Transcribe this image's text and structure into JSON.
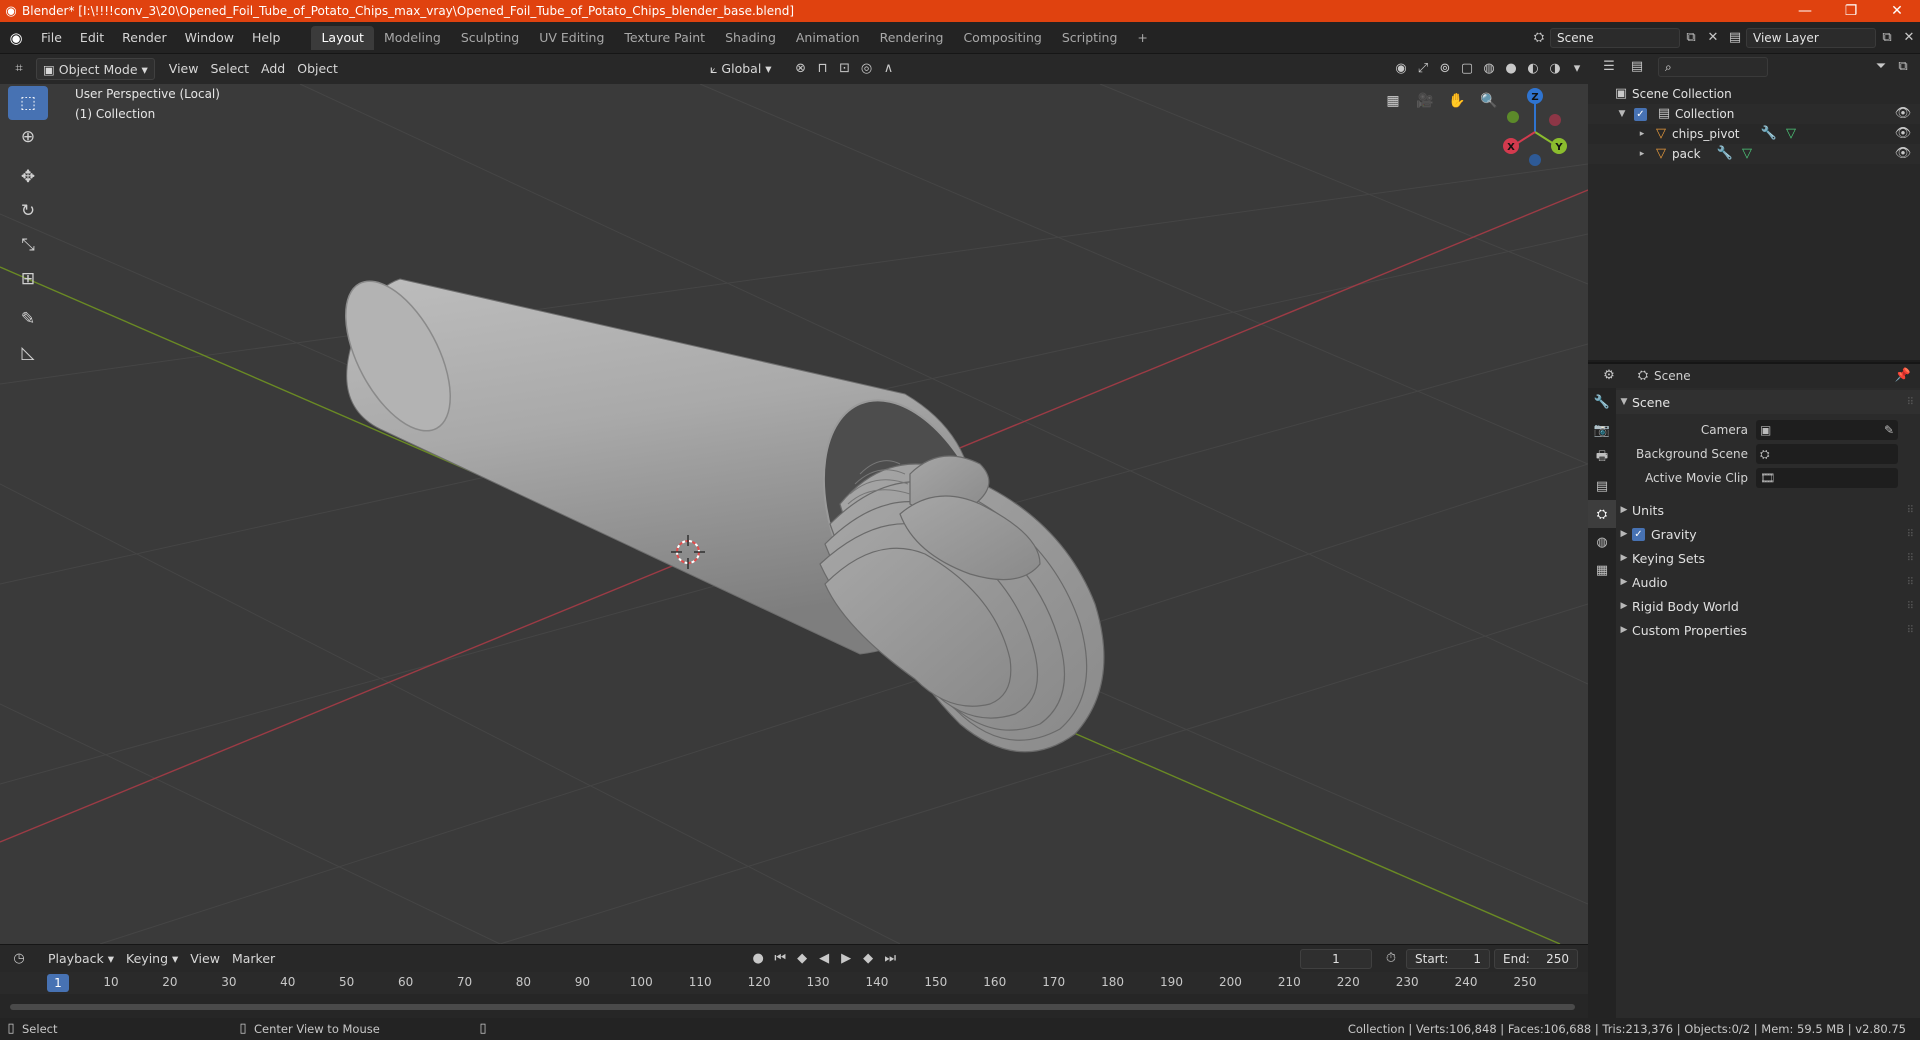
{
  "window": {
    "title": "Blender* [I:\\!!!!conv_3\\20\\Opened_Foil_Tube_of_Potato_Chips_max_vray\\Opened_Foil_Tube_of_Potato_Chips_blender_base.blend]",
    "minimize": "—",
    "maximize": "❐",
    "close": "✕"
  },
  "menu": [
    "File",
    "Edit",
    "Render",
    "Window",
    "Help"
  ],
  "workspaces": [
    "Layout",
    "Modeling",
    "Sculpting",
    "UV Editing",
    "Texture Paint",
    "Shading",
    "Animation",
    "Rendering",
    "Compositing",
    "Scripting"
  ],
  "active_workspace": "Layout",
  "add_workspace": "+",
  "scene_selector": {
    "value": "Scene"
  },
  "view_layer": {
    "value": "View Layer"
  },
  "viewport_header": {
    "mode": "Object Mode",
    "view": "View",
    "select": "Select",
    "add": "Add",
    "object": "Object",
    "orientation": "Global"
  },
  "viewport": {
    "perspective": "User Perspective (Local)",
    "collection": "(1) Collection",
    "gizmo": {
      "x": "X",
      "y": "Y",
      "z": "Z"
    },
    "colors": {
      "background": "#3a3a3a",
      "grid": "#454545",
      "x_axis": "#9c3b45",
      "y_axis": "#6a8a24",
      "mesh": "#a8a8a8"
    }
  },
  "timeline": {
    "playback": "Playback",
    "keying": "Keying",
    "view": "View",
    "marker": "Marker",
    "current_frame": "1",
    "start_label": "Start:",
    "start": "1",
    "end_label": "End:",
    "end": "250",
    "ruler": [
      "10",
      "20",
      "30",
      "40",
      "50",
      "60",
      "70",
      "80",
      "90",
      "100",
      "110",
      "120",
      "130",
      "140",
      "150",
      "160",
      "170",
      "180",
      "190",
      "200",
      "210",
      "220",
      "230",
      "240",
      "250"
    ],
    "ruler_current": "1"
  },
  "statusbar": {
    "select": "Select",
    "center_view": "Center View to Mouse",
    "stats": "Collection | Verts:106,848 | Faces:106,688 | Tris:213,376 | Objects:0/2 | Mem: 59.5 MB | v2.80.75"
  },
  "outliner": {
    "scene_collection": "Scene Collection",
    "collection": "Collection",
    "items": [
      "chips_pivot",
      "pack"
    ]
  },
  "properties": {
    "header": "Scene",
    "panel": "Scene",
    "camera_label": "Camera",
    "background_scene_label": "Background Scene",
    "active_movie_clip_label": "Active Movie Clip",
    "subpanels": [
      "Units",
      "Gravity",
      "Keying Sets",
      "Audio",
      "Rigid Body World",
      "Custom Properties"
    ]
  },
  "accent": "#4772b3",
  "title_bar_color": "#e0420f"
}
